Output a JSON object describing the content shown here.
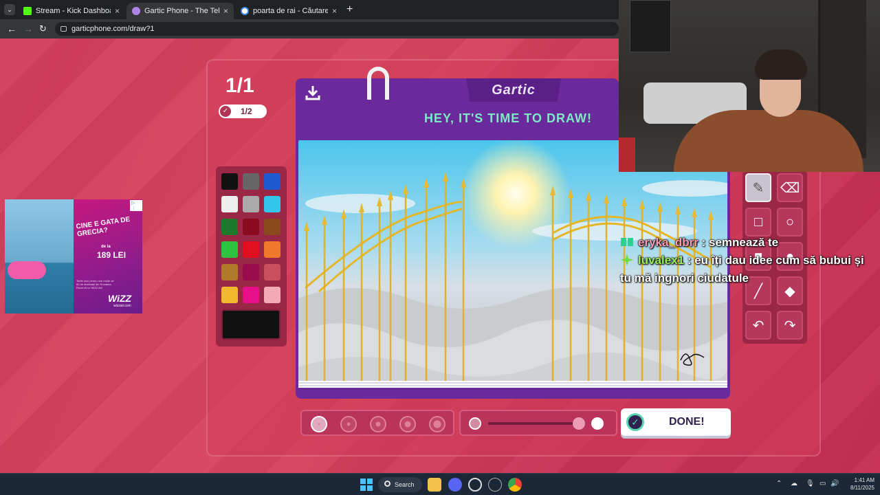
{
  "browser": {
    "tabs": [
      {
        "title": "Stream - Kick Dashboard",
        "favicon_color": "#53fc18",
        "active": false
      },
      {
        "title": "Gartic Phone - The Telephone G",
        "favicon_color": "#b084e6",
        "active": true
      },
      {
        "title": "poarta de rai - Căutare Google",
        "favicon_color": "#ffffff",
        "active": false
      }
    ],
    "close_glyph": "×",
    "new_tab_glyph": "+",
    "menu_glyph": "⌄",
    "url": "garticphone.com/draw?1"
  },
  "game": {
    "round": "1/1",
    "progress": "1/2",
    "logo": "Gartic",
    "headline": "HEY, IT'S TIME TO DRAW!",
    "done_label": "DONE!",
    "palette": [
      "#111111",
      "#666666",
      "#1f5bd0",
      "#eeeeee",
      "#aaaaaa",
      "#34c6ea",
      "#1d7a2d",
      "#8a0a1e",
      "#8a4a1d",
      "#2dc33f",
      "#e0101e",
      "#f07a2b",
      "#b07a2b",
      "#9a0a4e",
      "#c94f5c",
      "#f2b92e",
      "#e80f8a",
      "#f4aab6"
    ],
    "current_color": "#111111",
    "tools": [
      "pencil-icon",
      "eraser-icon",
      "rectangle-icon",
      "ellipse-icon",
      "filled-rectangle-icon",
      "filled-ellipse-icon",
      "line-icon",
      "bucket-icon",
      "undo-icon",
      "redo-icon"
    ],
    "brush_sizes_count": 5,
    "selected_brush": 1
  },
  "ad": {
    "headline": "CINE E GATA DE GRECIA?",
    "price_prefix": "de la",
    "price": "189 LEI",
    "fine_print": "Tarife mini pentru mai multe de 60 de destinații din România. Rezervă cu WIZZ Air!",
    "brand": "WiZZ",
    "brand_url": "wizzair.com",
    "ad_choices": "▷ ⋮"
  },
  "chat": [
    {
      "user": "eryka_dbrr",
      "badge": "gift-badge-icon",
      "text": " : semnează te"
    },
    {
      "user": "luvalex1",
      "badge": "sparkle-badge-icon",
      "text": " : eu îți dau idee cum să bubui și tu mă ingnori ciudatule"
    }
  ],
  "taskbar": {
    "search_label": "Search",
    "time": "1:41 AM",
    "date": "8/11/2025"
  }
}
